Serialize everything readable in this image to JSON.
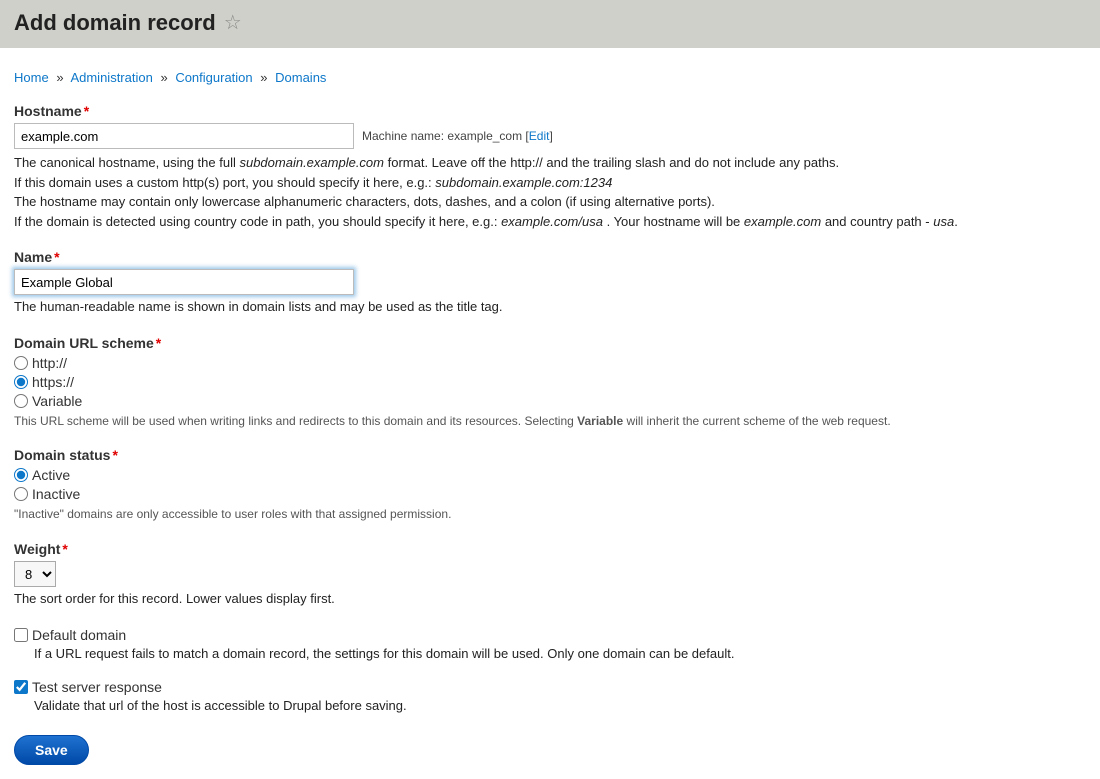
{
  "header": {
    "title": "Add domain record"
  },
  "breadcrumb": {
    "items": [
      "Home",
      "Administration",
      "Configuration",
      "Domains"
    ],
    "sep": "»"
  },
  "hostname": {
    "label": "Hostname",
    "value": "example.com",
    "machine_label": "Machine name:",
    "machine_value": "example_com",
    "edit_label": "Edit",
    "help_l1a": "The canonical hostname, using the full ",
    "help_l1b_italic": "subdomain.example.com",
    "help_l1c": " format. Leave off the http:// and the trailing slash and do not include any paths.",
    "help_l2a": "If this domain uses a custom http(s) port, you should specify it here, e.g.: ",
    "help_l2b_italic": "subdomain.example.com:1234",
    "help_l3": "The hostname may contain only lowercase alphanumeric characters, dots, dashes, and a colon (if using alternative ports).",
    "help_l4a": "If the domain is detected using country code in path, you should specify it here, e.g.: ",
    "help_l4b_italic": "example.com/usa",
    "help_l4c": " . Your hostname will be ",
    "help_l4d_italic": "example.com",
    "help_l4e": " and country path - ",
    "help_l4f_italic": "usa",
    "help_l4g": "."
  },
  "name": {
    "label": "Name",
    "value": "Example Global",
    "help": "The human-readable name is shown in domain lists and may be used as the title tag."
  },
  "scheme": {
    "label": "Domain URL scheme",
    "options": {
      "http": "http://",
      "https": "https://",
      "variable": "Variable"
    },
    "help_a": "This URL scheme will be used when writing links and redirects to this domain and its resources. Selecting ",
    "help_b_bold": "Variable",
    "help_c": " will inherit the current scheme of the web request."
  },
  "status": {
    "label": "Domain status",
    "options": {
      "active": "Active",
      "inactive": "Inactive"
    },
    "help": "\"Inactive\" domains are only accessible to user roles with that assigned permission."
  },
  "weight": {
    "label": "Weight",
    "value": "8",
    "help": "The sort order for this record. Lower values display first."
  },
  "default_domain": {
    "label": "Default domain",
    "help": "If a URL request fails to match a domain record, the settings for this domain will be used. Only one domain can be default."
  },
  "test_server": {
    "label": "Test server response",
    "help": "Validate that url of the host is accessible to Drupal before saving."
  },
  "save": {
    "label": "Save"
  }
}
